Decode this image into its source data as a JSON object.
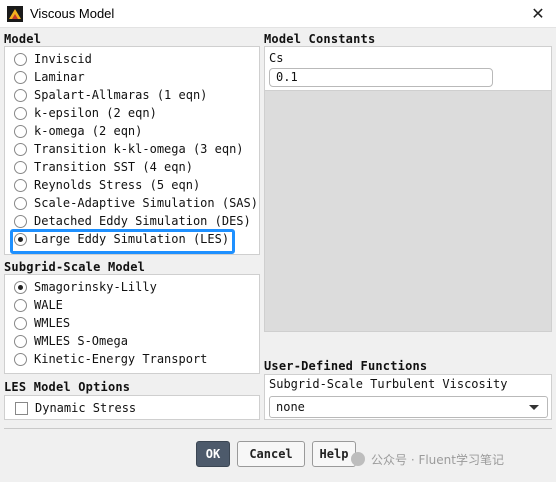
{
  "window": {
    "title": "Viscous Model"
  },
  "model": {
    "label": "Model",
    "options": [
      {
        "label": "Inviscid",
        "selected": false
      },
      {
        "label": "Laminar",
        "selected": false
      },
      {
        "label": "Spalart-Allmaras (1 eqn)",
        "selected": false
      },
      {
        "label": "k-epsilon (2 eqn)",
        "selected": false
      },
      {
        "label": "k-omega (2 eqn)",
        "selected": false
      },
      {
        "label": "Transition k-kl-omega (3 eqn)",
        "selected": false
      },
      {
        "label": "Transition SST (4 eqn)",
        "selected": false
      },
      {
        "label": "Reynolds Stress (5 eqn)",
        "selected": false
      },
      {
        "label": "Scale-Adaptive Simulation (SAS)",
        "selected": false
      },
      {
        "label": "Detached Eddy Simulation (DES)",
        "selected": false
      },
      {
        "label": "Large Eddy Simulation (LES)",
        "selected": true
      }
    ]
  },
  "subgrid": {
    "label": "Subgrid-Scale Model",
    "options": [
      {
        "label": "Smagorinsky-Lilly",
        "selected": true
      },
      {
        "label": "WALE",
        "selected": false
      },
      {
        "label": "WMLES",
        "selected": false
      },
      {
        "label": "WMLES S-Omega",
        "selected": false
      },
      {
        "label": "Kinetic-Energy Transport",
        "selected": false
      }
    ]
  },
  "les_options": {
    "label": "LES Model Options",
    "dynamic_stress": {
      "label": "Dynamic Stress",
      "checked": false
    }
  },
  "constants": {
    "label": "Model Constants",
    "cs_label": "Cs",
    "cs_value": "0.1"
  },
  "udf": {
    "label": "User-Defined Functions",
    "field_label": "Subgrid-Scale Turbulent Viscosity",
    "value": "none"
  },
  "buttons": {
    "ok": "OK",
    "cancel": "Cancel",
    "help": "Help"
  },
  "watermark": "公众号 · Fluent学习笔记",
  "colors": {
    "highlight": "#1e90ff",
    "ok_button": "#4d5a6b"
  }
}
